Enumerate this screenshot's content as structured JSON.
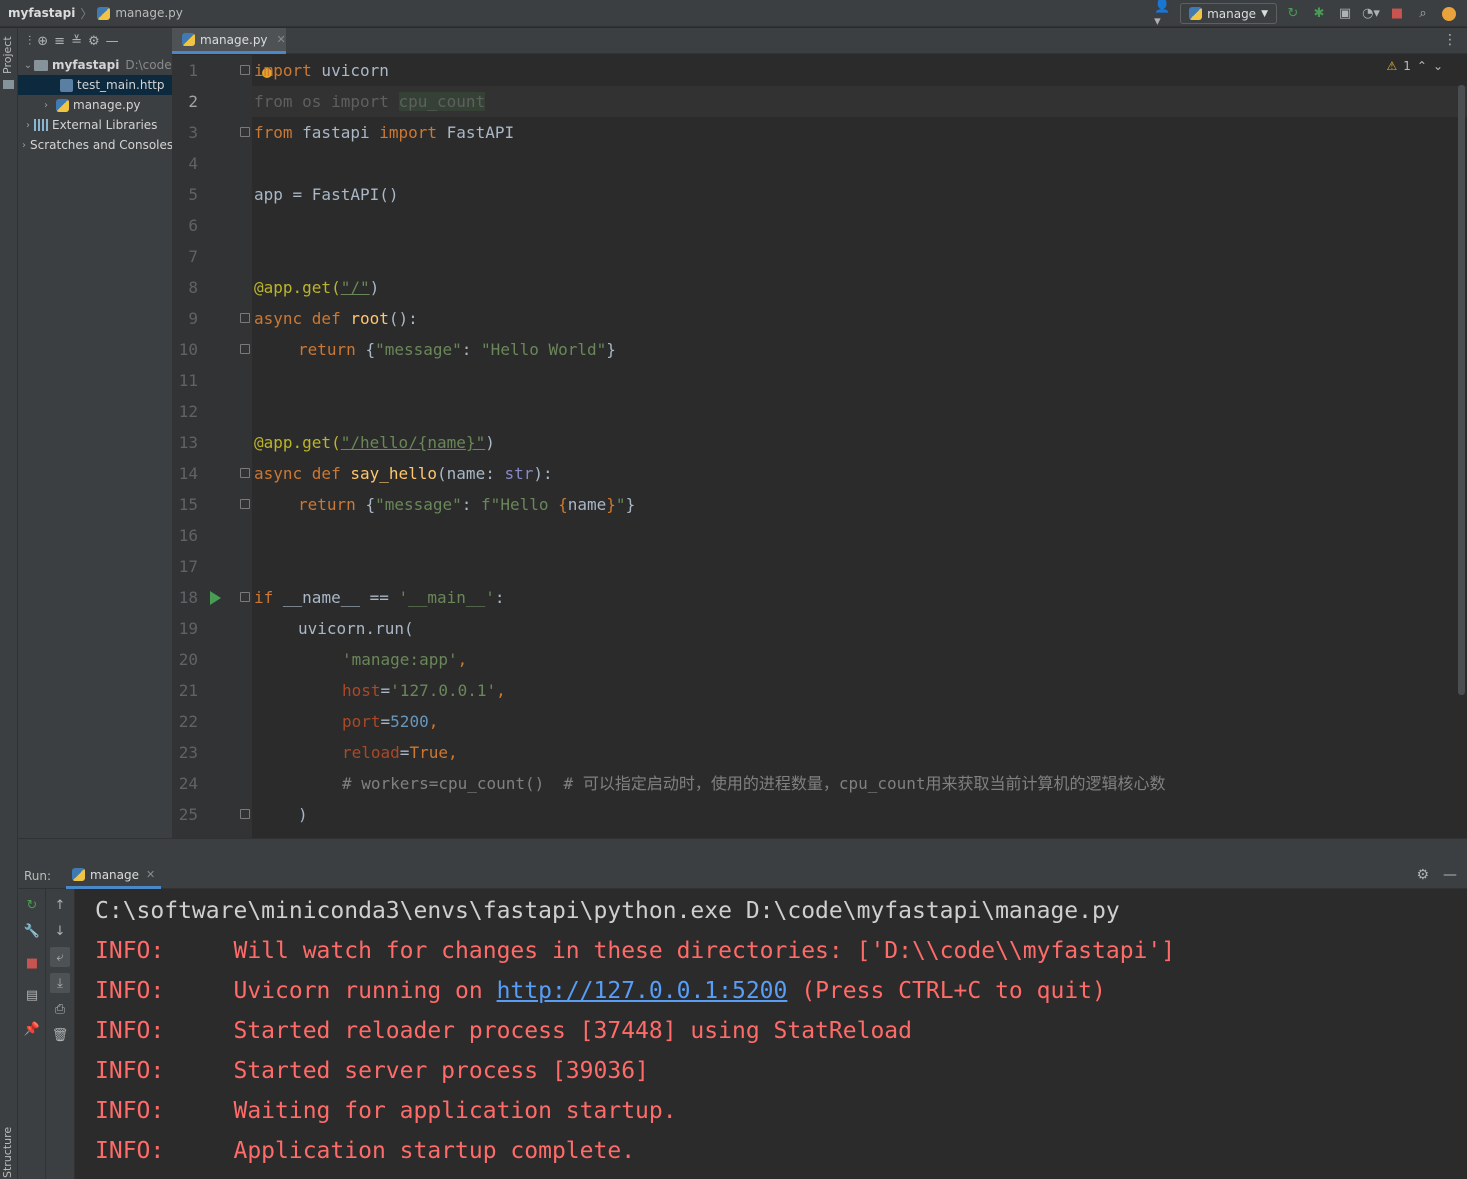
{
  "titlebar": {
    "project": "myfastapi",
    "file": "manage.py",
    "run_config": "manage"
  },
  "sidebar": {
    "project_label": "Project",
    "structure_label": "Structure",
    "tree": [
      {
        "label": "myfastapi",
        "path": "D:\\code"
      },
      {
        "label": "test_main.http"
      },
      {
        "label": "manage.py"
      },
      {
        "label": "External Libraries"
      },
      {
        "label": "Scratches and Consoles"
      }
    ]
  },
  "editor": {
    "tab_label": "manage.py",
    "inspection_count": "1",
    "line_numbers": [
      "1",
      "2",
      "3",
      "4",
      "5",
      "6",
      "7",
      "8",
      "9",
      "10",
      "11",
      "12",
      "13",
      "14",
      "15",
      "16",
      "17",
      "18",
      "19",
      "20",
      "21",
      "22",
      "23",
      "24",
      "25"
    ],
    "current_line": "2",
    "code": {
      "l1_kw": "import",
      "l1_mod": " uvicorn",
      "l2": "from os import ",
      "l2_name": "cpu_count",
      "l3_kw1": "from",
      "l3_mod": " fastapi ",
      "l3_kw2": "import",
      "l3_name": " FastAPI",
      "l5": "app = FastAPI()",
      "l8_dec": "@app.get(",
      "l8_str": "\"/\"",
      "l8_end": ")",
      "l9_kw": "async def ",
      "l9_fn": "root",
      "l9_end": "():",
      "l10_kw": "return ",
      "l10_b1": "{",
      "l10_s1": "\"message\"",
      "l10_c": ": ",
      "l10_s2": "\"Hello World\"",
      "l10_b2": "}",
      "l13_dec": "@app.get(",
      "l13_str": "\"/hello/{name}\"",
      "l13_end": ")",
      "l14_kw": "async def ",
      "l14_fn": "say_hello",
      "l14_a": "(name: ",
      "l14_bi": "str",
      "l14_end": "):",
      "l15_kw": "return ",
      "l15_b1": "{",
      "l15_s1": "\"message\"",
      "l15_c": ": ",
      "l15_s2": "f\"Hello ",
      "l15_i1": "{",
      "l15_v": "name",
      "l15_i2": "}",
      "l15_s3": "\"",
      "l15_b2": "}",
      "l18_kw": "if ",
      "l18_a": "__name__ == ",
      "l18_str": "'__main__'",
      "l18_end": ":",
      "l19": "uvicorn.run(",
      "l20_str": "'manage:app'",
      "l20_end": ",",
      "l21_pm": "host",
      "l21_eq": "=",
      "l21_str": "'127.0.0.1'",
      "l21_end": ",",
      "l22_pm": "port",
      "l22_eq": "=",
      "l22_num": "5200",
      "l22_end": ",",
      "l23_pm": "reload",
      "l23_eq": "=",
      "l23_kw": "True",
      "l23_end": ",",
      "l24": "# workers=cpu_count()  # 可以指定启动时，使用的进程数量，cpu_count用来获取当前计算机的逻辑核心数",
      "l25": ")"
    }
  },
  "run": {
    "label": "Run:",
    "tab_label": "manage",
    "lines": {
      "cmd": "C:\\software\\miniconda3\\envs\\fastapi\\python.exe D:\\code\\myfastapi\\manage.py",
      "l1": "INFO:     Will watch for changes in these directories: ['D:\\\\code\\\\myfastapi']",
      "l2a": "INFO:     Uvicorn running on ",
      "l2link": "http://127.0.0.1:5200",
      "l2b": " (Press CTRL+C to quit)",
      "l3": "INFO:     Started reloader process [37448] using StatReload",
      "l4": "INFO:     Started server process [39036]",
      "l5": "INFO:     Waiting for application startup.",
      "l6": "INFO:     Application startup complete."
    }
  },
  "colors": {
    "keyword": "#cc7832",
    "string": "#6a8759",
    "decorator": "#bbb529",
    "function": "#ffc66d",
    "number": "#6897bb",
    "error_text": "#ff6b68",
    "link": "#589df6"
  }
}
